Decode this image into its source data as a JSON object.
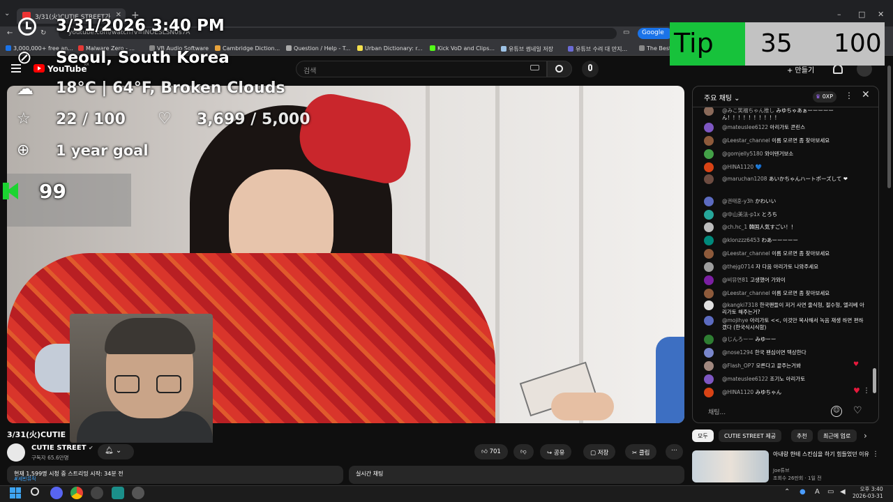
{
  "browser": {
    "tab_title": "3/31(火)CUTIE STREET가",
    "new_tab": "+",
    "address": "youtube.com/watch?v=INOESLSN0s7A",
    "google_button": "Google",
    "window_controls": [
      "–",
      "□",
      "✕"
    ],
    "bookmarks": [
      {
        "label": "3,000,000+ free an...",
        "color": "#1a73e8"
      },
      {
        "label": "Malware Zero - ...",
        "color": "#e53935"
      },
      {
        "label": "VB Audio Software",
        "color": "#888888"
      },
      {
        "label": "Cambridge Diction...",
        "color": "#e8a33c"
      },
      {
        "label": "Question / Help - T...",
        "color": "#aaaaaa"
      },
      {
        "label": "Urban Dictionary: r...",
        "color": "#f4e04d"
      },
      {
        "label": "Kick VoD and Clips...",
        "color": "#53fc18"
      },
      {
        "label": "유튜브 썸네일 저장",
        "color": "#9ec3e6"
      },
      {
        "label": "유튜브 수려 대 만지...",
        "color": "#6b6bd6"
      },
      {
        "label": "The Best",
        "color": "#888888"
      }
    ]
  },
  "youtube_header": {
    "logo_text": "YouTube",
    "logo_suffix": "KR",
    "search_placeholder": "검색",
    "create_label": "+ 만들기"
  },
  "overlay": {
    "datetime": "3/31/2026 3:40 PM",
    "location": "Seoul, South Korea",
    "weather": "18°C | 64°F, Broken Clouds",
    "star_count": "22 / 100",
    "heart_count": "3,699 / 5,000",
    "goal": "1 year goal",
    "pinned_value": "99",
    "tip_label": "Tip",
    "tip_current": "35",
    "tip_goal": "100"
  },
  "chat": {
    "title": "주요 채팅",
    "xp": "0XP",
    "input_placeholder": "채팅...",
    "messages": [
      {
        "author": "@みこ笑福ちゃん推し",
        "text": "みゆちゃあぁーーーーーん！！！！！！！！！！",
        "avatar": "#8a6a5a"
      },
      {
        "author": "@mateuslee6122",
        "text": "아리가토 콘린스",
        "avatar": "#7e57c2"
      },
      {
        "author": "@Leestar_channel",
        "text": "이름 모르면 좀 찾아보세요",
        "avatar": "#8d5a3b"
      },
      {
        "author": "@gomjelly5180",
        "text": "와이텐거보소",
        "avatar": "#43a047"
      },
      {
        "author": "@HINA1120",
        "text": "💙",
        "avatar": "#d84315"
      },
      {
        "author": "@maruchan1208",
        "text": "あいかちゃんハートポーズして ❤",
        "avatar": "#6d4c41"
      },
      {
        "author": "@권태훈-y3h",
        "text": "かわいい",
        "avatar": "#5c6bc0"
      },
      {
        "author": "@中山美法-p1x",
        "text": "とろち",
        "avatar": "#26a69a"
      },
      {
        "author": "@ch.hc_1",
        "text": "韓国人気すごい！！",
        "avatar": "#bdbdbd"
      },
      {
        "author": "@klonzzz6453",
        "text": "わあーーーーー",
        "avatar": "#00897b"
      },
      {
        "author": "@Leestar_channel",
        "text": "이름 모르면 좀 찾아보세요",
        "avatar": "#8d5a3b"
      },
      {
        "author": "@thejg0714",
        "text": "자 다음 아리가토 나와주세요",
        "avatar": "#9e9e9e"
      },
      {
        "author": "@비뮤연81",
        "text": "고생했어 가와이",
        "avatar": "#7b1fa2"
      },
      {
        "author": "@Leestar_channel",
        "text": "이름 모르면 좀 찾아보세요",
        "avatar": "#8d5a3b"
      },
      {
        "author": "@kangki7318",
        "text": "한국팬들이 저거 사면 줄식형, 절수형, 엘리베 아리가토 해주는거?",
        "avatar": "#e0e0e0"
      },
      {
        "author": "@mojihye",
        "text": "아리가토 <<, 이것만 복사해서 녹음 재생 하면 편하겠다 (한국식시식함)",
        "avatar": "#5c6bc0"
      },
      {
        "author": "@じんろーー",
        "text": "みゆーー",
        "avatar": "#2e7d32"
      },
      {
        "author": "@nose1294",
        "text": "한국 팬심이면 텍상한다",
        "avatar": "#7986cb"
      },
      {
        "author": "@Flash_OP7",
        "text": "모른다고 끝주는거봐",
        "avatar": "#a1887f"
      },
      {
        "author": "@mateuslee6122",
        "text": "조기노 아리가토",
        "avatar": "#7e57c2"
      },
      {
        "author": "@HINA1120",
        "text": "みゆちゃん",
        "avatar": "#d84315"
      }
    ]
  },
  "video_info": {
    "title": "3/31(火)CUTIE",
    "channel": "CUTIE STREET",
    "subscribers": "구독자 65.6만명",
    "likes": "701",
    "share": "공유",
    "save": "저장",
    "clip": "클립",
    "description": "현재 1,599명 시청 중 스트리밍 시작: 34분 전",
    "description_more": "#세빈뮤직",
    "live_chat_label": "실시간 채팅"
  },
  "related": {
    "chips": [
      "모두",
      "CUTIE STREET 제공",
      "추천",
      "최근에 업로"
    ],
    "video_title": "아내랑 한테 스킨십을 하기 힘들었던 이유",
    "video_channel": "Joe튜브",
    "video_meta": "조회수 26만회 · 1일 전"
  },
  "taskbar": {
    "time": "오후 3:40",
    "date": "2026-03-31",
    "lang": "A"
  }
}
